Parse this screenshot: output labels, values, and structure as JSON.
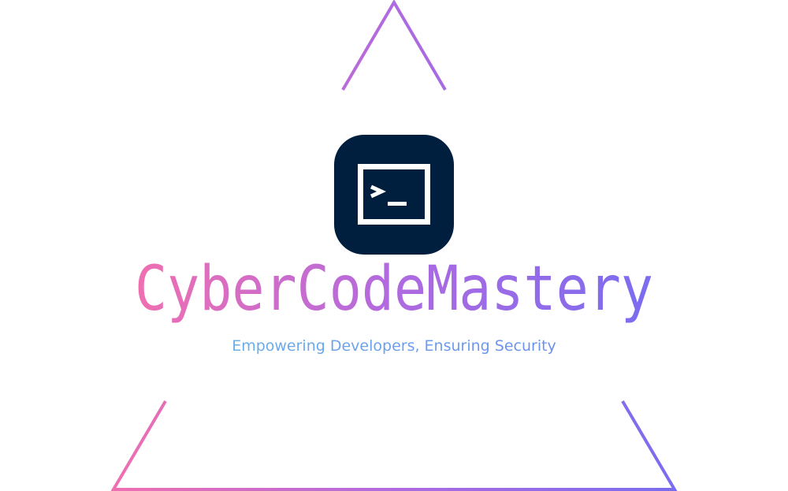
{
  "logo": {
    "brand_name": "CyberCodeMastery",
    "tagline": "Empowering Developers, Ensuring Security",
    "icon": "terminal-prompt-icon",
    "colors": {
      "icon_background": "#001f3f",
      "icon_glyph": "#ffffff",
      "gradient_start": "#f06fb0",
      "gradient_mid": "#b06ae0",
      "gradient_end": "#7a6cf0",
      "tagline_start": "#6aaee8",
      "tagline_end": "#6a8ef0"
    }
  }
}
